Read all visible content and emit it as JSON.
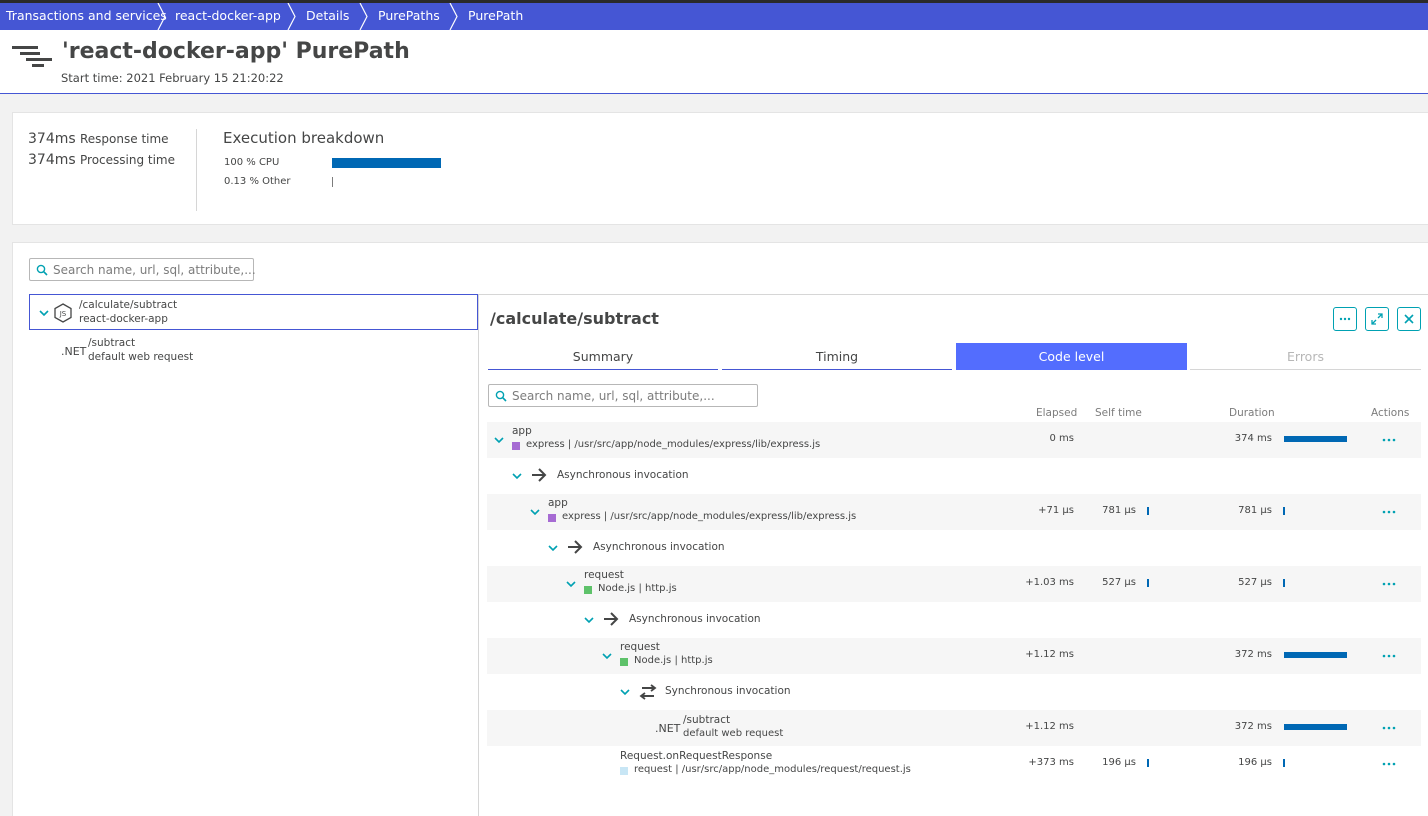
{
  "breadcrumbs": [
    "Transactions and services",
    "react-docker-app",
    "Details",
    "PurePaths",
    "PurePath"
  ],
  "page": {
    "title": "'react-docker-app' PurePath",
    "start_time": "Start time: 2021 February 15 21:20:22"
  },
  "summary": {
    "response_time_value": "374ms",
    "response_time_label": "Response time",
    "processing_time_value": "374ms",
    "processing_time_label": "Processing time",
    "breakdown_title": "Execution breakdown",
    "breakdown": [
      {
        "label": "100 % CPU",
        "percent": 100
      },
      {
        "label": "0.13 % Other",
        "percent": 0.13
      }
    ]
  },
  "left_search_placeholder": "Search name, url, sql, attribute,...",
  "tree": {
    "root_name": "/calculate/subtract",
    "root_sub": "react-docker-app",
    "child_badge": ".NET",
    "child_name": "/subtract",
    "child_sub": "default web request"
  },
  "detail": {
    "title": "/calculate/subtract",
    "tabs": [
      "Summary",
      "Timing",
      "Code level",
      "Errors"
    ],
    "active_tab": "Code level",
    "search_placeholder": "Search name, url, sql, attribute,...",
    "columns": {
      "elapsed": "Elapsed",
      "self_time": "Self time",
      "duration": "Duration",
      "actions": "Actions"
    }
  },
  "code_rows": [
    {
      "kind": "node",
      "name": "app",
      "sub": "express | /usr/src/app/node_modules/express/lib/express.js",
      "square_color": "#a66bd3",
      "elapsed": "0 ms",
      "self": "",
      "duration": "374 ms",
      "duration_fraction": 1.0
    },
    {
      "kind": "async",
      "label": "Asynchronous invocation"
    },
    {
      "kind": "node",
      "name": "app",
      "sub": "express | /usr/src/app/node_modules/express/lib/express.js",
      "square_color": "#a66bd3",
      "elapsed": "+71 µs",
      "self": "781 µs",
      "duration": "781 µs",
      "duration_fraction": 0.002
    },
    {
      "kind": "async",
      "label": "Asynchronous invocation"
    },
    {
      "kind": "node",
      "name": "request",
      "sub": "Node.js | http.js",
      "square_color": "#5ec26a",
      "elapsed": "+1.03 ms",
      "self": "527 µs",
      "duration": "527 µs",
      "duration_fraction": 0.0014
    },
    {
      "kind": "async",
      "label": "Asynchronous invocation"
    },
    {
      "kind": "node",
      "name": "request",
      "sub": "Node.js | http.js",
      "square_color": "#5ec26a",
      "elapsed": "+1.12 ms",
      "self": "",
      "duration": "372 ms",
      "duration_fraction": 0.995
    },
    {
      "kind": "sync",
      "label": "Synchronous invocation"
    },
    {
      "kind": "net",
      "badge": ".NET",
      "name": "/subtract",
      "sub": "default web request",
      "elapsed": "+1.12 ms",
      "self": "",
      "duration": "372 ms",
      "duration_fraction": 0.995
    },
    {
      "kind": "leaf",
      "name": "Request.onRequestResponse",
      "sub": "request | /usr/src/app/node_modules/request/request.js",
      "square_color": "#c8e6f5",
      "elapsed": "+373 ms",
      "self": "196 µs",
      "duration": "196 µs",
      "duration_fraction": 0.0005
    }
  ],
  "icons": [
    "hamburger-purepath-icon",
    "search-icon",
    "nodejs-icon",
    "chevron-down-icon",
    "more-icon",
    "expand-icon",
    "close-icon",
    "async-arrow-icon",
    "sync-arrows-icon"
  ],
  "colors": {
    "accent": "#4556d4",
    "tab_active": "#536dfe",
    "bar": "#0068b4",
    "teal": "#00a1b2"
  }
}
